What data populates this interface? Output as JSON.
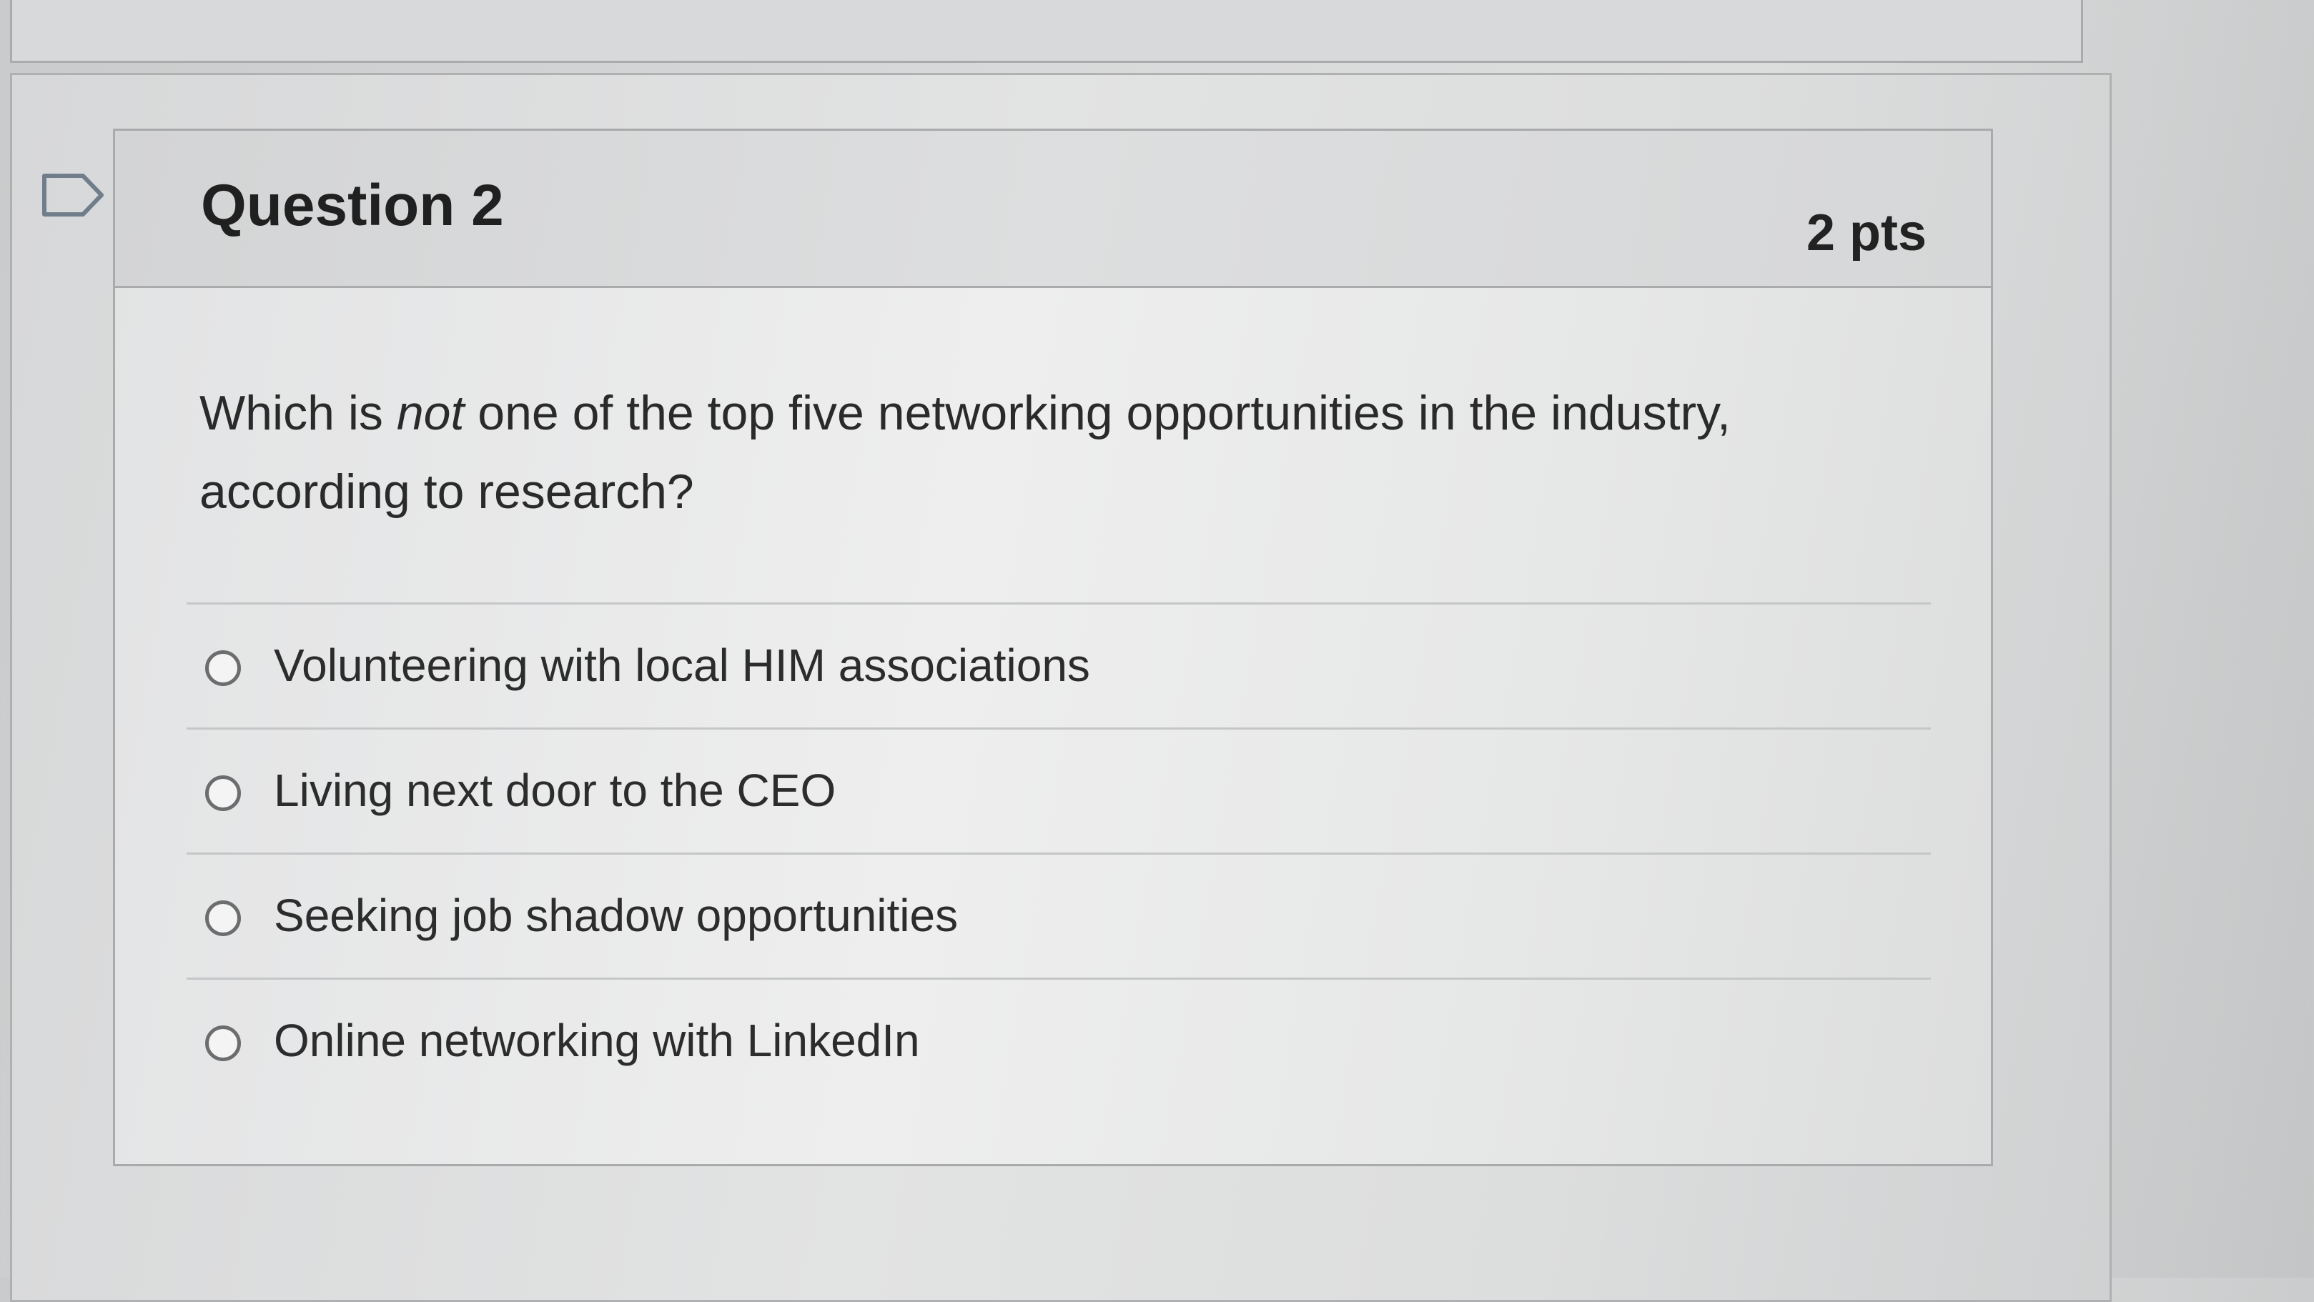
{
  "question": {
    "title": "Question 2",
    "points": "2 pts",
    "text_before": "Which is ",
    "text_emphasis": "not",
    "text_after": " one of the top five networking opportunities in the industry, according to research?"
  },
  "answers": [
    {
      "label": "Volunteering with local HIM associations"
    },
    {
      "label": "Living next door to the CEO"
    },
    {
      "label": "Seeking job shadow opportunities"
    },
    {
      "label": "Online networking with LinkedIn"
    }
  ],
  "icons": {
    "flag": "flag-outline-icon",
    "radio": "radio-unselected-icon"
  },
  "colors": {
    "border": "#a9abac",
    "text": "#262626"
  }
}
